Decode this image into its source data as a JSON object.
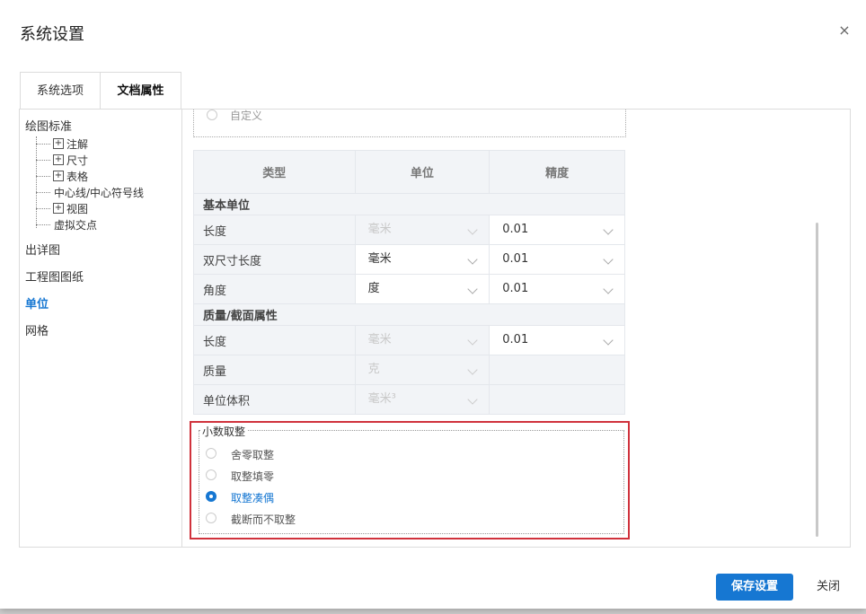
{
  "dialog": {
    "title": "系统设置",
    "close_label": "×"
  },
  "tabs": [
    {
      "label": "系统选项"
    },
    {
      "label": "文档属性"
    }
  ],
  "nav": {
    "drawing_standard": "绘图标准",
    "tree": [
      {
        "label": "注解",
        "expand": "+"
      },
      {
        "label": "尺寸",
        "expand": "+"
      },
      {
        "label": "表格",
        "expand": "+"
      },
      {
        "label": "中心线/中心符号线",
        "expand": ""
      },
      {
        "label": "视图",
        "expand": "+"
      },
      {
        "label": "虚拟交点",
        "expand": ""
      }
    ],
    "detailing": "出详图",
    "drawing_sheet": "工程图图纸",
    "units": "单位",
    "grid": "网格"
  },
  "previous_option": "自定义",
  "table": {
    "headers": {
      "type": "类型",
      "unit": "单位",
      "precision": "精度"
    },
    "group_basic": "基本单位",
    "basic": [
      {
        "name": "长度",
        "unit": "毫米",
        "precision": "0.01"
      },
      {
        "name": "双尺寸长度",
        "unit": "毫米",
        "precision": "0.01"
      },
      {
        "name": "角度",
        "unit": "度",
        "precision": "0.01"
      }
    ],
    "group_mass": "质量/截面属性",
    "mass": [
      {
        "name": "长度",
        "unit": "毫米",
        "precision": "0.01"
      },
      {
        "name": "质量",
        "unit": "克",
        "precision": ""
      },
      {
        "name": "单位体积",
        "unit": "毫米³",
        "precision": ""
      }
    ]
  },
  "rounding": {
    "legend": "小数取整",
    "options": [
      "舍零取整",
      "取整填零",
      "取整凑偶",
      "截断而不取整"
    ],
    "selected": "取整凑偶"
  },
  "footer": {
    "save_label": "保存设置",
    "close_label": "关闭"
  },
  "colors": {
    "accent": "#1677d2",
    "highlight_border": "#d0323c"
  }
}
